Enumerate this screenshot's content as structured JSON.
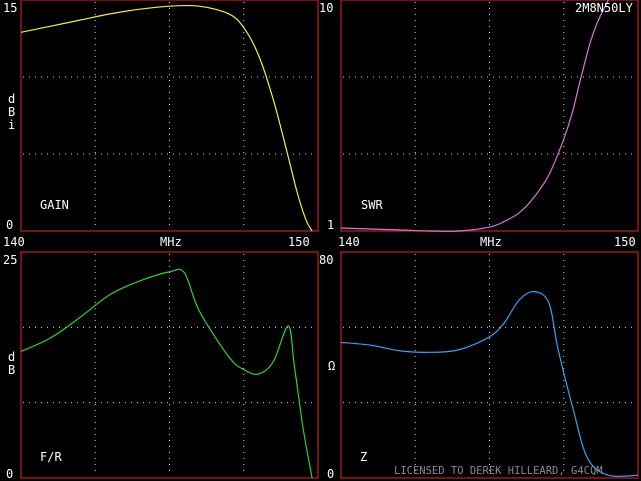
{
  "header": {
    "model_name": "2M8N50LY"
  },
  "footer": {
    "license_text": "LICENSED TO DEREK HILLEARD, G4CQM"
  },
  "colors": {
    "background": "#000000",
    "frame": "#a01818",
    "grid": "#d8d8d8",
    "text": "#ffffff",
    "gain": "#f0f040",
    "swr": "#e070e0",
    "fr": "#30d030",
    "z": "#3aa0f0"
  },
  "chart_data": [
    {
      "id": "gain",
      "type": "line",
      "label": "GAIN",
      "unit_label": "dBi",
      "x_labels": {
        "left": "140",
        "mid": "MHz",
        "right": "150"
      },
      "y_labels": {
        "top": "15",
        "bottom": "0"
      },
      "xlim": [
        140,
        150
      ],
      "ylim": [
        0,
        15
      ],
      "grid": true,
      "color": "#f0f040",
      "series": [
        {
          "x": [
            140,
            141,
            142,
            143,
            144,
            145,
            146,
            147,
            147.5,
            148,
            148.5,
            149,
            149.3,
            149.6,
            149.8
          ],
          "y": [
            12.9,
            13.3,
            13.7,
            14.1,
            14.4,
            14.6,
            14.6,
            14.1,
            13.2,
            11.4,
            8.5,
            4.8,
            2.5,
            0.7,
            0
          ]
        }
      ]
    },
    {
      "id": "swr",
      "type": "line",
      "label": "SWR",
      "unit_label": "",
      "x_labels": {
        "left": "140",
        "mid": "MHz",
        "right": "150"
      },
      "y_labels": {
        "top": "10",
        "bottom": "1"
      },
      "xlim": [
        140,
        150
      ],
      "ylim": [
        1,
        10
      ],
      "scale": "log",
      "grid": true,
      "color": "#e070e0",
      "series": [
        {
          "x": [
            140,
            141,
            142,
            143,
            144,
            145,
            145.5,
            146,
            146.5,
            147,
            147.5,
            147.8,
            148,
            148.2,
            148.4,
            148.6,
            148.8,
            149
          ],
          "y": [
            1.03,
            1.02,
            1.01,
            1.0,
            1.0,
            1.04,
            1.1,
            1.2,
            1.4,
            1.75,
            2.5,
            3.3,
            4.2,
            5.3,
            6.6,
            7.8,
            8.9,
            10
          ]
        }
      ]
    },
    {
      "id": "fr",
      "type": "line",
      "label": "F/R",
      "unit_label": "dB",
      "x_labels": {
        "left": "",
        "mid": "",
        "right": ""
      },
      "y_labels": {
        "top": "25",
        "bottom": "0"
      },
      "xlim": [
        140,
        150
      ],
      "ylim": [
        0,
        25
      ],
      "grid": true,
      "color": "#30d030",
      "series": [
        {
          "x": [
            140,
            141,
            142,
            143,
            144,
            145,
            145.5,
            146,
            147,
            147.5,
            148,
            148.5,
            149,
            149.2,
            149.5,
            149.8
          ],
          "y": [
            14,
            15.5,
            17.8,
            20.3,
            21.8,
            22.8,
            22.7,
            18.5,
            13.4,
            12,
            11.5,
            12.9,
            16.8,
            12.5,
            5.5,
            0
          ]
        }
      ]
    },
    {
      "id": "z",
      "type": "line",
      "label": "Z",
      "unit_label": "Ω",
      "x_labels": {
        "left": "",
        "mid": "",
        "right": ""
      },
      "y_labels": {
        "top": "80",
        "bottom": "0"
      },
      "xlim": [
        140,
        150
      ],
      "ylim": [
        0,
        80
      ],
      "grid": true,
      "color": "#3aa0f0",
      "series": [
        {
          "x": [
            140,
            141,
            142,
            143,
            144,
            145,
            145.5,
            146,
            146.5,
            147,
            147.3,
            147.8,
            148.3,
            149,
            150
          ],
          "y": [
            48,
            47,
            45,
            44.5,
            45.5,
            50,
            55,
            63,
            66,
            62,
            46,
            25,
            7,
            1,
            1
          ]
        }
      ]
    }
  ]
}
